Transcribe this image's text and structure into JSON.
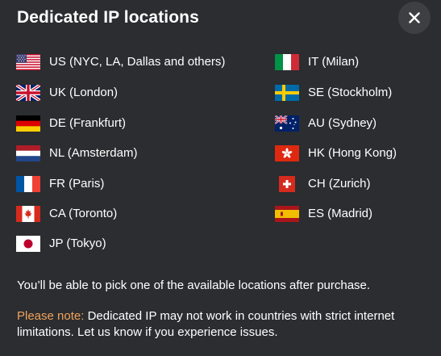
{
  "dialog": {
    "title": "Dedicated IP locations",
    "close_icon": "close-icon"
  },
  "locations": [
    {
      "label": "US (NYC, LA, Dallas and others)",
      "flag": "flag-us"
    },
    {
      "label": "UK (London)",
      "flag": "flag-uk"
    },
    {
      "label": "DE (Frankfurt)",
      "flag": "flag-de"
    },
    {
      "label": "NL (Amsterdam)",
      "flag": "flag-nl"
    },
    {
      "label": "FR (Paris)",
      "flag": "flag-fr"
    },
    {
      "label": "CA (Toronto)",
      "flag": "flag-ca"
    },
    {
      "label": "JP (Tokyo)",
      "flag": "flag-jp"
    },
    {
      "label": "IT (Milan)",
      "flag": "flag-it"
    },
    {
      "label": "SE (Stockholm)",
      "flag": "flag-se"
    },
    {
      "label": "AU (Sydney)",
      "flag": "flag-au"
    },
    {
      "label": "HK (Hong Kong)",
      "flag": "flag-hk"
    },
    {
      "label": "CH (Zurich)",
      "flag": "flag-ch"
    },
    {
      "label": "ES (Madrid)",
      "flag": "flag-es"
    }
  ],
  "info_text": "You’ll be able to pick one of the available locations after purchase.",
  "note": {
    "prefix": "Please note:",
    "text": " Dedicated IP may not work in countries with strict internet limitations. Let us know if you experience issues."
  },
  "colors": {
    "background": "#2b2d30",
    "close_button": "#3d3f43",
    "note_accent": "#f2a25b",
    "text": "#ffffff"
  }
}
